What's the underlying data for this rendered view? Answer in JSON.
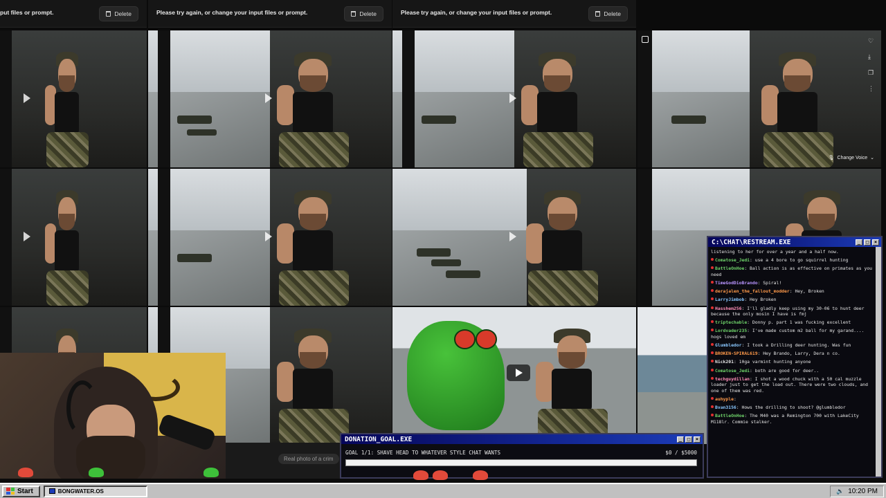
{
  "errors": [
    {
      "message": "put files or prompt.",
      "delete_label": "Delete"
    },
    {
      "message": "Please try again, or change your input files or prompt.",
      "delete_label": "Delete"
    },
    {
      "message": "Please try again, or change your input files or prompt.",
      "delete_label": "Delete"
    }
  ],
  "tile_overlay": {
    "change_voice": "Change Voice"
  },
  "realphoto_prompt": "Real photo of a crim",
  "chat": {
    "title": "C:\\CHAT\\RESTREAM.EXE",
    "messages": [
      {
        "user": "",
        "text": "listening to her for over a year and a half now."
      },
      {
        "user": "Comatose_Jedi",
        "text": "use a 4 bore to go squirrel hunting"
      },
      {
        "user": "BattleOnHoe",
        "text": "Ball action is as effective on primates as you need"
      },
      {
        "user": "TimeGodDioBrando",
        "text": "Spiral!"
      },
      {
        "user": "derajalen_the_fallout_modder",
        "text": "Hey, Broken"
      },
      {
        "user": "LarryJimbob",
        "text": "Hey Broken"
      },
      {
        "user": "Hasshem256",
        "text": "I'll gladly keep using my 30-06 to hunt deer because the only mosin I have is fmj"
      },
      {
        "user": "triptechable",
        "text": "Donny p. part 1 was fucking excellent"
      },
      {
        "user": "Lordvader235",
        "text": "I've made custom m2 ball for my garand.... hogs loved em"
      },
      {
        "user": "Glumbledor",
        "text": "I took a Drilling deer hunting. Was fun"
      },
      {
        "user": "BROKEN-SPIRAL619",
        "text": "Hey Brando, Larry, Dera n co."
      },
      {
        "user": "Nick201",
        "text": "10ga varmint hunting anyone"
      },
      {
        "user": "Comatose_Jedi",
        "text": "both are good for deer.."
      },
      {
        "user": "techguydillan",
        "text": "I shot a wood chuck with a 50 cal muzzle loader just to get the load out. There were two clouds, and one of them was red."
      },
      {
        "user": "auhyple",
        "text": ""
      },
      {
        "user": "Bvan3156",
        "text": "Hows the drilling to shoot? @glumbledor"
      },
      {
        "user": "BattleOnHoe",
        "text": "The M40 was a Remington 700 with LakeCity M118lr. Commie stalker."
      }
    ]
  },
  "donation": {
    "title": "DONATION_GOAL.EXE",
    "goal": "GOAL 1/1: SHAVE HEAD TO WHATEVER STYLE CHAT WANTS",
    "amount": "$0 / $5000",
    "progress": 0
  },
  "taskbar": {
    "start_label": "Start",
    "item_label": "BONGWATER.OS",
    "clock": "10:20 PM"
  },
  "colors": {
    "title_bar": "#06065a",
    "accent_green": "#3ec13a",
    "accent_red": "#e03030"
  }
}
